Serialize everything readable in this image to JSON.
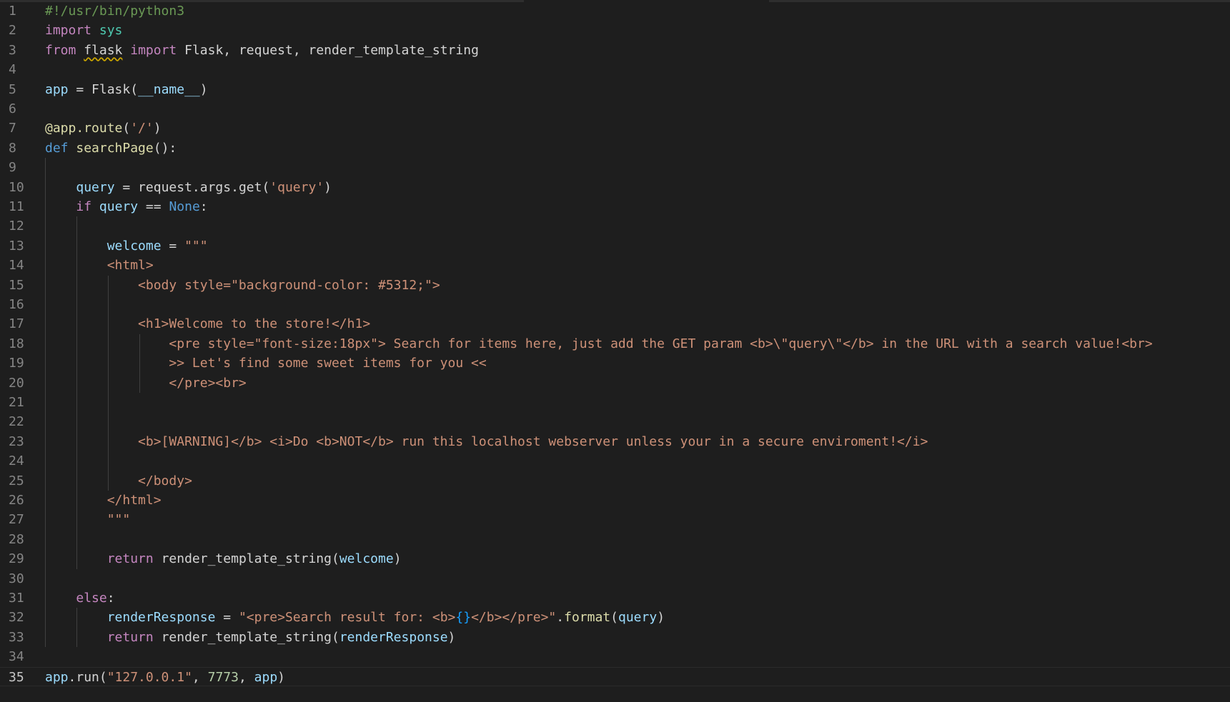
{
  "editor": {
    "language": "python",
    "current_line": 35,
    "lines": [
      {
        "n": "1",
        "tokens": [
          [
            "#!/usr/bin/python3",
            "c-comment"
          ]
        ]
      },
      {
        "n": "2",
        "tokens": [
          [
            "import",
            "c-kw"
          ],
          [
            " ",
            ""
          ],
          [
            "sys",
            "c-mod"
          ]
        ]
      },
      {
        "n": "3",
        "tokens": [
          [
            "from",
            "c-kw"
          ],
          [
            " ",
            ""
          ],
          [
            "flask",
            "c-punc squiggle"
          ],
          [
            " ",
            ""
          ],
          [
            "import",
            "c-kw"
          ],
          [
            " Flask, request, render_template_string",
            "c-punc"
          ]
        ]
      },
      {
        "n": "4",
        "tokens": []
      },
      {
        "n": "5",
        "tokens": [
          [
            "app",
            "c-var"
          ],
          [
            " = Flask(",
            "c-punc"
          ],
          [
            "__name__",
            "c-var"
          ],
          [
            ")",
            "c-punc"
          ]
        ]
      },
      {
        "n": "6",
        "tokens": []
      },
      {
        "n": "7",
        "tokens": [
          [
            "@app.route",
            "c-fn"
          ],
          [
            "(",
            "c-punc"
          ],
          [
            "'/'",
            "c-str"
          ],
          [
            ")",
            "c-punc"
          ]
        ]
      },
      {
        "n": "8",
        "tokens": [
          [
            "def",
            "c-def"
          ],
          [
            " ",
            ""
          ],
          [
            "searchPage",
            "c-fn"
          ],
          [
            "():",
            "c-punc"
          ]
        ]
      },
      {
        "n": "9",
        "tokens": []
      },
      {
        "n": "10",
        "tokens": [
          [
            "    ",
            ""
          ],
          [
            "query",
            "c-var"
          ],
          [
            " = request.args.get(",
            "c-punc"
          ],
          [
            "'query'",
            "c-str"
          ],
          [
            ")",
            "c-punc"
          ]
        ]
      },
      {
        "n": "11",
        "tokens": [
          [
            "    ",
            ""
          ],
          [
            "if",
            "c-kw"
          ],
          [
            " ",
            ""
          ],
          [
            "query",
            "c-var"
          ],
          [
            " == ",
            "c-punc"
          ],
          [
            "None",
            "c-def"
          ],
          [
            ":",
            "c-punc"
          ]
        ]
      },
      {
        "n": "12",
        "tokens": []
      },
      {
        "n": "13",
        "tokens": [
          [
            "        ",
            ""
          ],
          [
            "welcome",
            "c-var"
          ],
          [
            " = ",
            "c-punc"
          ],
          [
            "\"\"\"",
            "c-str"
          ]
        ]
      },
      {
        "n": "14",
        "tokens": [
          [
            "        <html>",
            "c-str"
          ]
        ]
      },
      {
        "n": "15",
        "tokens": [
          [
            "            <body style=\"background-color: #5312;\">",
            "c-str"
          ]
        ]
      },
      {
        "n": "16",
        "tokens": []
      },
      {
        "n": "17",
        "tokens": [
          [
            "            <h1>Welcome to the store!</h1>",
            "c-str"
          ]
        ]
      },
      {
        "n": "18",
        "tokens": [
          [
            "                <pre style=\"font-size:18px\"> Search for items here, just add the GET param <b>\\\"query\\\"</b> in the URL with a search value!<br>",
            "c-str"
          ]
        ]
      },
      {
        "n": "19",
        "tokens": [
          [
            "                >> Let's find some sweet items for you <<",
            "c-str"
          ]
        ]
      },
      {
        "n": "20",
        "tokens": [
          [
            "                </pre><br>",
            "c-str"
          ]
        ]
      },
      {
        "n": "21",
        "tokens": []
      },
      {
        "n": "22",
        "tokens": []
      },
      {
        "n": "23",
        "tokens": [
          [
            "            <b>[WARNING]</b> <i>Do <b>NOT</b> run this localhost webserver unless your in a secure enviroment!</i>",
            "c-str"
          ]
        ]
      },
      {
        "n": "24",
        "tokens": []
      },
      {
        "n": "25",
        "tokens": [
          [
            "            </body>",
            "c-str"
          ]
        ]
      },
      {
        "n": "26",
        "tokens": [
          [
            "        </html>",
            "c-str"
          ]
        ]
      },
      {
        "n": "27",
        "tokens": [
          [
            "        \"\"\"",
            "c-str"
          ]
        ]
      },
      {
        "n": "28",
        "tokens": []
      },
      {
        "n": "29",
        "tokens": [
          [
            "        ",
            ""
          ],
          [
            "return",
            "c-kw"
          ],
          [
            " render_template_string(",
            "c-punc"
          ],
          [
            "welcome",
            "c-var"
          ],
          [
            ")",
            "c-punc"
          ]
        ]
      },
      {
        "n": "30",
        "tokens": []
      },
      {
        "n": "31",
        "tokens": [
          [
            "    ",
            ""
          ],
          [
            "else",
            "c-kw"
          ],
          [
            ":",
            "c-punc"
          ]
        ]
      },
      {
        "n": "32",
        "tokens": [
          [
            "        ",
            ""
          ],
          [
            "renderResponse",
            "c-var"
          ],
          [
            " = ",
            "c-punc"
          ],
          [
            "\"<pre>Search result for: <b>",
            "c-str"
          ],
          [
            "{}",
            "c-brace"
          ],
          [
            "</b></pre>\"",
            "c-str"
          ],
          [
            ".",
            "c-punc"
          ],
          [
            "format",
            "c-fn"
          ],
          [
            "(",
            "c-punc"
          ],
          [
            "query",
            "c-var"
          ],
          [
            ")",
            "c-punc"
          ]
        ]
      },
      {
        "n": "33",
        "tokens": [
          [
            "        ",
            ""
          ],
          [
            "return",
            "c-kw"
          ],
          [
            " render_template_string(",
            "c-punc"
          ],
          [
            "renderResponse",
            "c-var"
          ],
          [
            ")",
            "c-punc"
          ]
        ]
      },
      {
        "n": "34",
        "tokens": []
      },
      {
        "n": "35",
        "tokens": [
          [
            "app",
            "c-var"
          ],
          [
            ".run(",
            "c-punc"
          ],
          [
            "\"127.0.0.1\"",
            "c-str"
          ],
          [
            ", ",
            "c-punc"
          ],
          [
            "7773",
            "c-num"
          ],
          [
            ", ",
            "c-punc"
          ],
          [
            "app",
            "c-var"
          ],
          [
            ")",
            "c-punc"
          ]
        ]
      }
    ]
  }
}
